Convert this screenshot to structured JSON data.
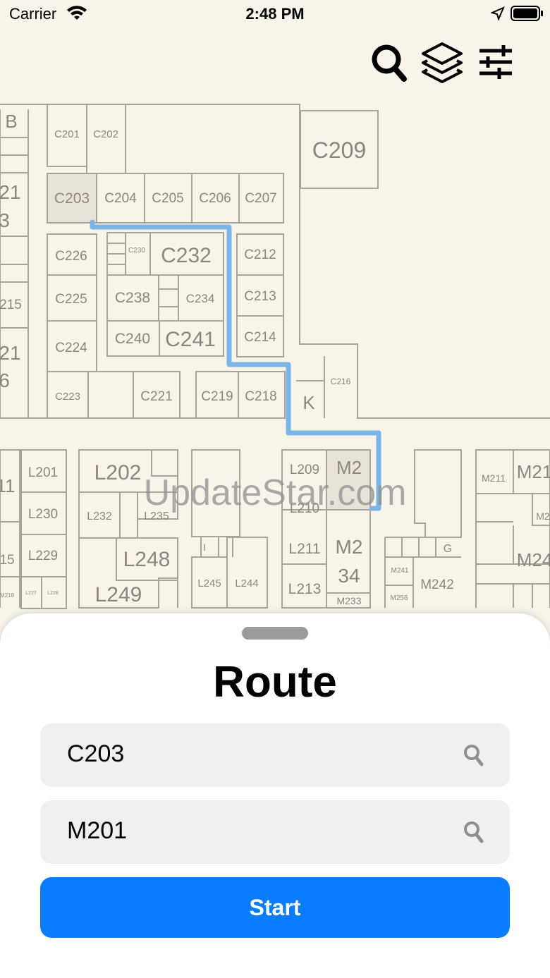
{
  "status_bar": {
    "carrier": "Carrier",
    "time": "2:48 PM"
  },
  "toolbar": {
    "icons": [
      "search-icon",
      "layers-icon",
      "sliders-icon"
    ]
  },
  "map": {
    "watermark": "UpdateStar.com",
    "rooms_c": [
      "C201",
      "C202",
      "C209",
      "C203",
      "C204",
      "C205",
      "C206",
      "C207",
      "C226",
      "C230",
      "C232",
      "C212",
      "C225",
      "C238",
      "C234",
      "C213",
      "C224",
      "C240",
      "C241",
      "C214",
      "C216",
      "C223",
      "C221",
      "C219",
      "C218",
      "K"
    ],
    "rooms_l": [
      "L201",
      "L202",
      "L209",
      "M2",
      "L230",
      "L232",
      "L235",
      "L210",
      "M211",
      "M21",
      "L229",
      "L248",
      "L211",
      "M2",
      "G",
      "M24",
      "L227",
      "L228",
      "L249",
      "L245",
      "L244",
      "L213",
      "34",
      "M241",
      "M242",
      "M233",
      "M256"
    ],
    "edge_labels": [
      "B",
      "21",
      "3",
      "215",
      "21",
      "6",
      "11",
      "15",
      "M218",
      "M2"
    ],
    "route_color": "#7ab6e8"
  },
  "route_sheet": {
    "title": "Route",
    "from_value": "C203",
    "to_value": "M201",
    "start_label": "Start"
  }
}
